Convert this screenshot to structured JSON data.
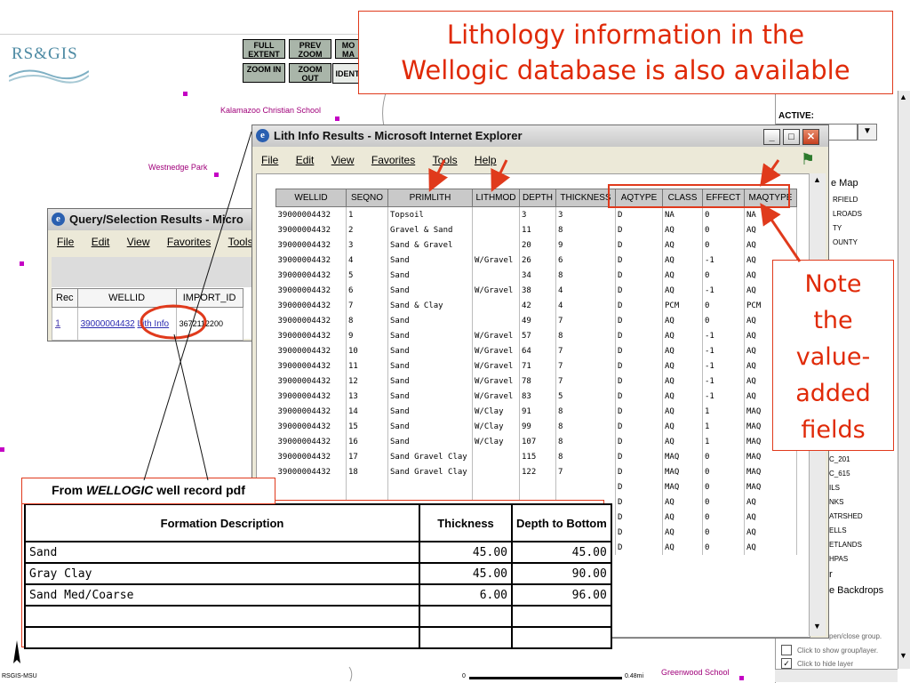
{
  "app": {
    "logo_text": "RS&GIS",
    "toolbar": {
      "full_extent": "FULL EXTENT",
      "prev_zoom": "PREV ZOOM",
      "more_map": "MO MA",
      "zoom_in": "ZOOM IN",
      "zoom_out": "ZOOM OUT",
      "identify": "IDENT"
    },
    "map_labels": {
      "kalamazoo": "Kalamazoo Christian School",
      "westnedge": "Westnedge Park",
      "greenwood": "Greenwood School",
      "credit": "RSGIS-MSU",
      "scale_zero": "0",
      "scale_end": "0.48mi"
    },
    "right_panel": {
      "active_label": "ACTIVE:",
      "items": [
        "e Map",
        "RFIELD",
        "LROADS",
        "TY",
        "OUNTY",
        "C_201",
        "C_615",
        "ILS",
        "NKS",
        "ATRSHED",
        "ELLS",
        "ETLANDS",
        "HPAS"
      ],
      "big_items": [
        "r",
        "e Backdrops"
      ],
      "footer": [
        "pen/close group.",
        "Click to show group/layer.",
        "Click to hide layer"
      ]
    }
  },
  "headline": {
    "line1": "Lithology information in the",
    "line2": "Wellogic database is also available"
  },
  "note": {
    "lines": [
      "Note",
      "the",
      "value-",
      "added",
      "fields"
    ]
  },
  "from_label": {
    "prefix": "From ",
    "source": "WELLOGIC",
    "suffix": " well record pdf"
  },
  "query_window": {
    "title": "Query/Selection Results - Micro",
    "menu": [
      "File",
      "Edit",
      "View",
      "Favorites",
      "Tools"
    ],
    "columns": [
      "Rec",
      "WELLID",
      "IMPORT_ID"
    ],
    "row": {
      "rec": "1",
      "wellid": "39000004432",
      "link": "Lith Info",
      "import_id": "3672112200"
    }
  },
  "lith_window": {
    "title": "Lith Info Results - Microsoft Internet Explorer",
    "menu": [
      "File",
      "Edit",
      "View",
      "Favorites",
      "Tools",
      "Help"
    ],
    "columns": [
      "WELLID",
      "SEQNO",
      "PRIMLITH",
      "LITHMOD",
      "DEPTH",
      "THICKNESS",
      "AQTYPE",
      "CLASS",
      "EFFECT",
      "MAQTYPE"
    ],
    "rows": [
      [
        "39000004432",
        "1",
        "Topsoil",
        "",
        "3",
        "3",
        "D",
        "NA",
        "0",
        "NA"
      ],
      [
        "39000004432",
        "2",
        "Gravel & Sand",
        "",
        "11",
        "8",
        "D",
        "AQ",
        "0",
        "AQ"
      ],
      [
        "39000004432",
        "3",
        "Sand & Gravel",
        "",
        "20",
        "9",
        "D",
        "AQ",
        "0",
        "AQ"
      ],
      [
        "39000004432",
        "4",
        "Sand",
        "W/Gravel",
        "26",
        "6",
        "D",
        "AQ",
        "-1",
        "AQ"
      ],
      [
        "39000004432",
        "5",
        "Sand",
        "",
        "34",
        "8",
        "D",
        "AQ",
        "0",
        "AQ"
      ],
      [
        "39000004432",
        "6",
        "Sand",
        "W/Gravel",
        "38",
        "4",
        "D",
        "AQ",
        "-1",
        "AQ"
      ],
      [
        "39000004432",
        "7",
        "Sand & Clay",
        "",
        "42",
        "4",
        "D",
        "PCM",
        "0",
        "PCM"
      ],
      [
        "39000004432",
        "8",
        "Sand",
        "",
        "49",
        "7",
        "D",
        "AQ",
        "0",
        "AQ"
      ],
      [
        "39000004432",
        "9",
        "Sand",
        "W/Gravel",
        "57",
        "8",
        "D",
        "AQ",
        "-1",
        "AQ"
      ],
      [
        "39000004432",
        "10",
        "Sand",
        "W/Gravel",
        "64",
        "7",
        "D",
        "AQ",
        "-1",
        "AQ"
      ],
      [
        "39000004432",
        "11",
        "Sand",
        "W/Gravel",
        "71",
        "7",
        "D",
        "AQ",
        "-1",
        "AQ"
      ],
      [
        "39000004432",
        "12",
        "Sand",
        "W/Gravel",
        "78",
        "7",
        "D",
        "AQ",
        "-1",
        "AQ"
      ],
      [
        "39000004432",
        "13",
        "Sand",
        "W/Gravel",
        "83",
        "5",
        "D",
        "AQ",
        "-1",
        "AQ"
      ],
      [
        "39000004432",
        "14",
        "Sand",
        "W/Clay",
        "91",
        "8",
        "D",
        "AQ",
        "1",
        "MAQ"
      ],
      [
        "39000004432",
        "15",
        "Sand",
        "W/Clay",
        "99",
        "8",
        "D",
        "AQ",
        "1",
        "MAQ"
      ],
      [
        "39000004432",
        "16",
        "Sand",
        "W/Clay",
        "107",
        "8",
        "D",
        "AQ",
        "1",
        "MAQ"
      ],
      [
        "39000004432",
        "17",
        "Sand Gravel Clay",
        "",
        "115",
        "8",
        "D",
        "MAQ",
        "0",
        "MAQ"
      ],
      [
        "39000004432",
        "18",
        "Sand Gravel Clay",
        "",
        "122",
        "7",
        "D",
        "MAQ",
        "0",
        "MAQ"
      ],
      [
        "",
        "",
        "",
        "",
        "",
        "",
        "D",
        "MAQ",
        "0",
        "MAQ"
      ],
      [
        "",
        "",
        "",
        "",
        "",
        "",
        "D",
        "AQ",
        "0",
        "AQ"
      ],
      [
        "",
        "",
        "",
        "",
        "",
        "",
        "D",
        "AQ",
        "0",
        "AQ"
      ],
      [
        "",
        "",
        "",
        "",
        "",
        "",
        "D",
        "AQ",
        "0",
        "AQ"
      ],
      [
        "",
        "",
        "",
        "",
        "",
        "",
        "D",
        "AQ",
        "0",
        "AQ"
      ]
    ]
  },
  "wellogic_record": {
    "columns": [
      "Formation Description",
      "Thickness",
      "Depth to Bottom"
    ],
    "rows": [
      [
        "Sand",
        "45.00",
        "45.00"
      ],
      [
        "Gray Clay",
        "45.00",
        "90.00"
      ],
      [
        "Sand Med/Coarse",
        "6.00",
        "96.00"
      ],
      [
        "",
        "",
        ""
      ],
      [
        "",
        "",
        ""
      ]
    ]
  },
  "colors": {
    "accent_red": "#e02a08",
    "map_label": "#a0007a",
    "toolbar_btn": "#a9b5a9",
    "table_header": "#c9c9c9"
  }
}
